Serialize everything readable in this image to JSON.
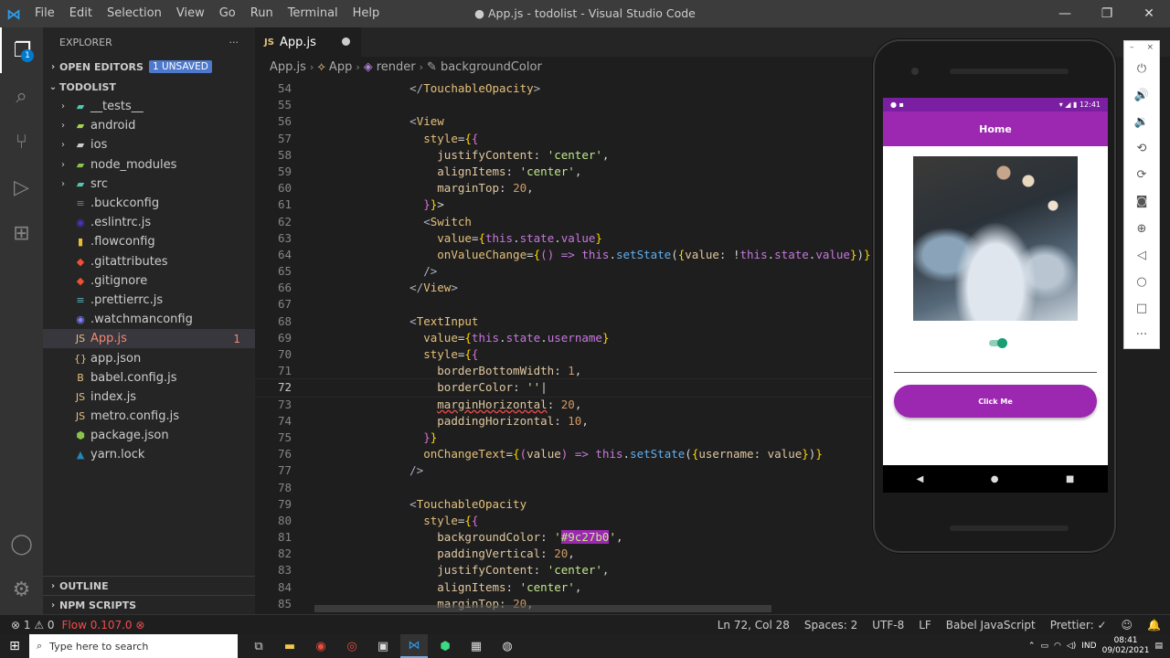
{
  "titlebar": {
    "menu": [
      "File",
      "Edit",
      "Selection",
      "View",
      "Go",
      "Run",
      "Terminal",
      "Help"
    ],
    "title": "● App.js - todolist - Visual Studio Code"
  },
  "activity": {
    "explorer_badge": "1"
  },
  "sidebar": {
    "title": "EXPLORER",
    "open_editors": "OPEN EDITORS",
    "unsaved": "1 UNSAVED",
    "project": "TODOLIST",
    "items": [
      {
        "label": "__tests__",
        "folder": true,
        "icon": "▰",
        "color": "#4ec9b0"
      },
      {
        "label": "android",
        "folder": true,
        "icon": "▰",
        "color": "#a5d34f"
      },
      {
        "label": "ios",
        "folder": true,
        "icon": "▰",
        "color": "#cccccc"
      },
      {
        "label": "node_modules",
        "folder": true,
        "icon": "▰",
        "color": "#8bc34a"
      },
      {
        "label": "src",
        "folder": true,
        "icon": "▰",
        "color": "#4ec9b0"
      },
      {
        "label": ".buckconfig",
        "folder": false,
        "icon": "≡",
        "color": "#6d8086"
      },
      {
        "label": ".eslintrc.js",
        "folder": false,
        "icon": "◉",
        "color": "#4b32c3"
      },
      {
        "label": ".flowconfig",
        "folder": false,
        "icon": "▮",
        "color": "#e8bd36"
      },
      {
        "label": ".gitattributes",
        "folder": false,
        "icon": "◆",
        "color": "#f05133"
      },
      {
        "label": ".gitignore",
        "folder": false,
        "icon": "◆",
        "color": "#f05133"
      },
      {
        "label": ".prettierrc.js",
        "folder": false,
        "icon": "≡",
        "color": "#56b3b4"
      },
      {
        "label": ".watchmanconfig",
        "folder": false,
        "icon": "◉",
        "color": "#8080ff"
      },
      {
        "label": "App.js",
        "folder": false,
        "icon": "JS",
        "color": "#e5c07b",
        "selected": true,
        "error": true,
        "count": "1"
      },
      {
        "label": "app.json",
        "folder": false,
        "icon": "{}",
        "color": "#e5c07b"
      },
      {
        "label": "babel.config.js",
        "folder": false,
        "icon": "B",
        "color": "#e5c07b"
      },
      {
        "label": "index.js",
        "folder": false,
        "icon": "JS",
        "color": "#e5c07b"
      },
      {
        "label": "metro.config.js",
        "folder": false,
        "icon": "JS",
        "color": "#e5c07b"
      },
      {
        "label": "package.json",
        "folder": false,
        "icon": "⬢",
        "color": "#8bc34a"
      },
      {
        "label": "yarn.lock",
        "folder": false,
        "icon": "▲",
        "color": "#2188b6"
      }
    ],
    "outline": "OUTLINE",
    "npm_scripts": "NPM SCRIPTS"
  },
  "editor": {
    "tab": "App.js",
    "breadcrumb": [
      "App.js",
      "App",
      "render",
      "backgroundColor"
    ]
  },
  "code_lines": [
    {
      "n": "54",
      "html": "      <span class='t-p'>&lt;/</span><span class='t-tag'>TouchableOpacity</span><span class='t-p'>&gt;</span>"
    },
    {
      "n": "55",
      "html": ""
    },
    {
      "n": "56",
      "html": "      <span class='t-p'>&lt;</span><span class='t-tag'>View</span>"
    },
    {
      "n": "57",
      "html": "        <span class='t-attr'>style</span>=<span class='t-br'>{</span><span class='t-br2'>{</span>"
    },
    {
      "n": "58",
      "html": "          <span class='t-key'>justifyContent</span>: <span class='t-str'>'center'</span>,"
    },
    {
      "n": "59",
      "html": "          <span class='t-key'>alignItems</span>: <span class='t-str'>'center'</span>,"
    },
    {
      "n": "60",
      "html": "          <span class='t-key'>marginTop</span>: <span class='t-num'>20</span>,"
    },
    {
      "n": "61",
      "html": "        <span class='t-br2'>}</span><span class='t-br'>}</span>&gt;"
    },
    {
      "n": "62",
      "html": "        <span class='t-p'>&lt;</span><span class='t-tag'>Switch</span>"
    },
    {
      "n": "63",
      "html": "          <span class='t-attr'>value</span>=<span class='t-br'>{</span><span class='t-kw'>this</span>.<span class='t-kw'>state</span>.<span class='t-kw'>value</span><span class='t-br'>}</span>"
    },
    {
      "n": "64",
      "html": "          <span class='t-attr'>onValueChange</span>=<span class='t-br'>{</span><span class='t-br2'>()</span> <span class='t-kw'>=&gt;</span> <span class='t-kw'>this</span>.<span class='t-fn'>setState</span>(<span class='t-br'>{</span><span class='t-key'>value</span>: !<span class='t-kw'>this</span>.<span class='t-kw'>state</span>.<span class='t-kw'>value</span><span class='t-br'>}</span>)<span class='t-br'>}</span>"
    },
    {
      "n": "65",
      "html": "        <span class='t-p'>/&gt;</span>"
    },
    {
      "n": "66",
      "html": "      <span class='t-p'>&lt;/</span><span class='t-tag'>View</span><span class='t-p'>&gt;</span>"
    },
    {
      "n": "67",
      "html": ""
    },
    {
      "n": "68",
      "html": "      <span class='t-p'>&lt;</span><span class='t-tag'>TextInput</span>"
    },
    {
      "n": "69",
      "html": "        <span class='t-attr'>value</span>=<span class='t-br'>{</span><span class='t-kw'>this</span>.<span class='t-kw'>state</span>.<span class='t-kw'>username</span><span class='t-br'>}</span>"
    },
    {
      "n": "70",
      "html": "        <span class='t-attr'>style</span>=<span class='t-br'>{</span><span class='t-br2'>{</span>"
    },
    {
      "n": "71",
      "html": "          <span class='t-key'>borderBottomWidth</span>: <span class='t-num'>1</span>,"
    },
    {
      "n": "72",
      "html": "          <span class='t-key'>borderColor</span>: <span class='t-str'>''</span>|",
      "current": true
    },
    {
      "n": "73",
      "html": "          <span class='t-key squiggle'>marginHorizontal</span>: <span class='t-num'>20</span>,"
    },
    {
      "n": "74",
      "html": "          <span class='t-key'>paddingHorizontal</span>: <span class='t-num'>10</span>,"
    },
    {
      "n": "75",
      "html": "        <span class='t-br2'>}</span><span class='t-br'>}</span>"
    },
    {
      "n": "76",
      "html": "        <span class='t-attr'>onChangeText</span>=<span class='t-br'>{</span><span class='t-br2'>(</span><span class='t-key'>value</span><span class='t-br2'>)</span> <span class='t-kw'>=&gt;</span> <span class='t-kw'>this</span>.<span class='t-fn'>setState</span>(<span class='t-br'>{</span><span class='t-key'>username</span>: <span class='t-key'>value</span><span class='t-br'>}</span>)<span class='t-br'>}</span>"
    },
    {
      "n": "77",
      "html": "      <span class='t-p'>/&gt;</span>"
    },
    {
      "n": "78",
      "html": ""
    },
    {
      "n": "79",
      "html": "      <span class='t-p'>&lt;</span><span class='t-tag'>TouchableOpacity</span>"
    },
    {
      "n": "80",
      "html": "        <span class='t-attr'>style</span>=<span class='t-br'>{</span><span class='t-br2'>{</span>"
    },
    {
      "n": "81",
      "html": "          <span class='t-key'>backgroundColor</span>: <span class='t-str'>'<span class=\"hl-color\">#9c27b0</span>'</span>,"
    },
    {
      "n": "82",
      "html": "          <span class='t-key'>paddingVertical</span>: <span class='t-num'>20</span>,"
    },
    {
      "n": "83",
      "html": "          <span class='t-key'>justifyContent</span>: <span class='t-str'>'center'</span>,"
    },
    {
      "n": "84",
      "html": "          <span class='t-key'>alignItems</span>: <span class='t-str'>'center'</span>,"
    },
    {
      "n": "85",
      "html": "          <span class='t-key'>marginTop</span>: <span class='t-num'>20</span>,"
    }
  ],
  "statusbar": {
    "errors": "⊗ 1 ⚠ 0",
    "flow": "Flow 0.107.0 ⊗",
    "right": [
      "Ln 72, Col 28",
      "Spaces: 2",
      "UTF-8",
      "LF",
      "Babel JavaScript",
      "Prettier: ✓"
    ]
  },
  "taskbar": {
    "search_placeholder": "Type here to search",
    "lang": "IND",
    "time": "08:41",
    "date": "09/02/2021"
  },
  "phone": {
    "time": "12:41",
    "appbar_title": "Home",
    "switch_on": true,
    "button_label": "Click Me",
    "accent": "#9c27b0"
  }
}
